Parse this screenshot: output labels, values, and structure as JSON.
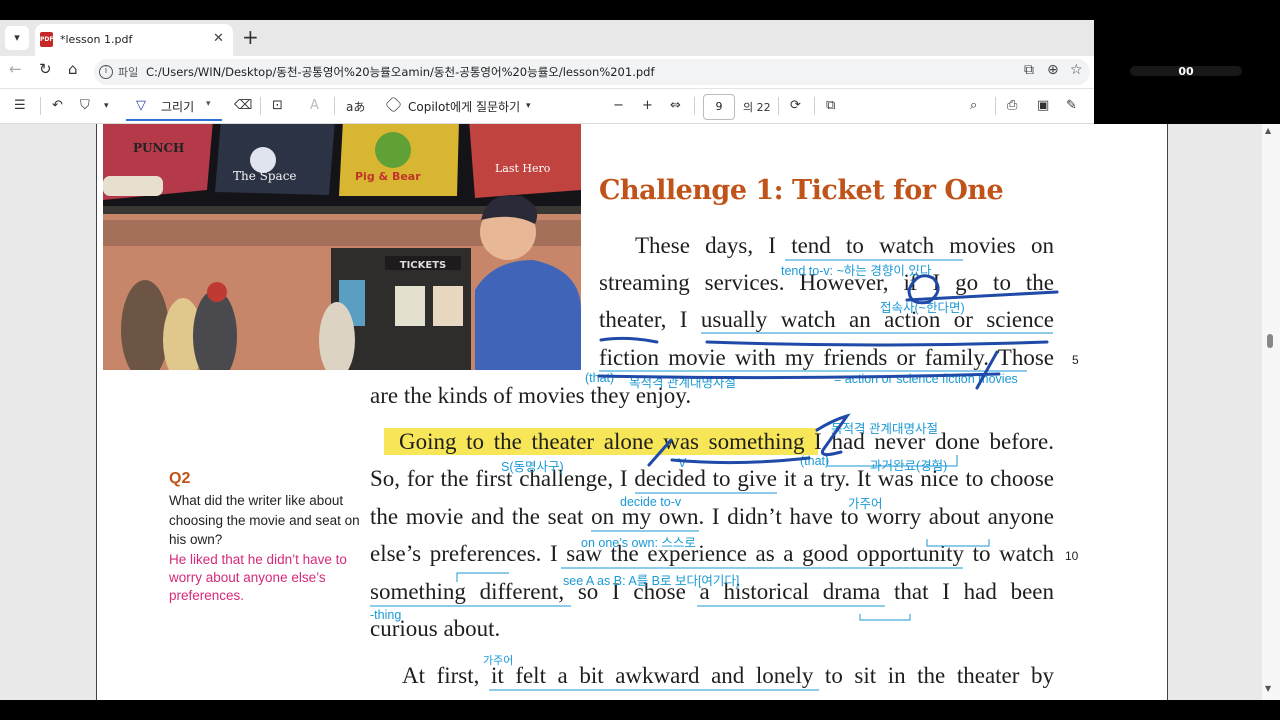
{
  "window": {
    "tab_title": "*lesson 1.pdf",
    "pdf_icon_text": "PDF",
    "file_label": "파일",
    "url": "C:/Users/WIN/Desktop/동천-공통영어%20능률오amin/동천-공통영어%20능률오/lesson%201.pdf",
    "timer_text": "00"
  },
  "toolbar": {
    "draw_label": "그리기",
    "copilot_label": "Copilot에게 질문하기",
    "page_number": "9",
    "page_total": "의 22",
    "text_icon": "aあ"
  },
  "document": {
    "heading": "Challenge 1: Ticket for One",
    "lines": [
      "These days, I tend to watch movies on",
      "streaming services. However, if I go to the",
      "theater, I usually watch an action or science",
      "fiction movie with my friends or family. Those",
      "are the kinds of movies they enjoy.",
      "Going to the theater alone was something I had never done before.",
      "So, for the first challenge, I decided to give it a try. It was nice to choose",
      "the movie and the seat on my own. I didn’t have to worry about anyone",
      "else’s preferences. I saw the experience as a good opportunity to watch",
      "something different, so I chose a historical drama that I had been",
      "curious about.",
      "At first, it felt a bit awkward and lonely to sit in the theater by"
    ],
    "line_numbers": [
      "5",
      "10"
    ],
    "poster_titles": [
      "PUNCH",
      "The Space",
      "Pig & Bear",
      "Last Hero"
    ],
    "sign_text": "TICKETS",
    "notes": {
      "tend_to": "tend to-v: ~하는 경향이 있다",
      "conj": "접속사(~한다면)",
      "that1": "(that)",
      "rel1": "목적격 관계대명사절",
      "action": "= action or science fiction movies",
      "rel2": "목적격 관계대명사절",
      "gerund": "S(동명사구)",
      "v": "V",
      "that2": "(that)",
      "perfect": "과거완료(경험)",
      "decide": "decide to-v",
      "dummy1": "가주어",
      "own": "on one’s own: 스스로",
      "seeA": "see A as B: A를 B로 보다[여기다]",
      "thing": "-thing",
      "dummy2": "가주어"
    },
    "question": {
      "title": "Q2",
      "text": "What did the writer like about choosing the movie and seat on his own?",
      "answer": "He liked that he didn’t have to worry about anyone else’s preferences."
    }
  }
}
